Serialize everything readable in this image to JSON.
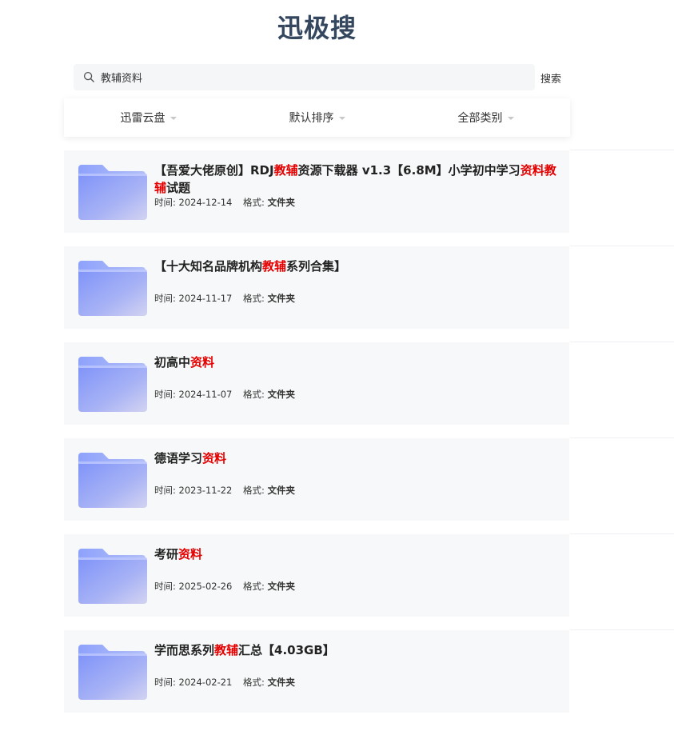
{
  "site": {
    "logo": "迅极搜"
  },
  "search": {
    "value": "教辅资料",
    "button_label": "搜索"
  },
  "filters": [
    {
      "label": "迅雷云盘"
    },
    {
      "label": "默认排序"
    },
    {
      "label": "全部类别"
    }
  ],
  "labels": {
    "time": "时间:",
    "format": "格式:"
  },
  "results": [
    {
      "title_parts": [
        {
          "text": "【吾爱大佬原创】RDJ",
          "hl": false
        },
        {
          "text": "教辅",
          "hl": true
        },
        {
          "text": "资源下载器 v1.3【6.8M】小学初中学习",
          "hl": false
        },
        {
          "text": "资料",
          "hl": true
        },
        {
          "text": "教辅",
          "hl": true
        },
        {
          "text": "试题",
          "hl": false
        }
      ],
      "date": "2024-12-14",
      "format": "文件夹"
    },
    {
      "title_parts": [
        {
          "text": "【十大知名品牌机构",
          "hl": false
        },
        {
          "text": "教辅",
          "hl": true
        },
        {
          "text": "系列合集】",
          "hl": false
        }
      ],
      "date": "2024-11-17",
      "format": "文件夹"
    },
    {
      "title_parts": [
        {
          "text": "初高中",
          "hl": false
        },
        {
          "text": "资料",
          "hl": true
        }
      ],
      "date": "2024-11-07",
      "format": "文件夹"
    },
    {
      "title_parts": [
        {
          "text": "德语学习",
          "hl": false
        },
        {
          "text": "资料",
          "hl": true
        }
      ],
      "date": "2023-11-22",
      "format": "文件夹"
    },
    {
      "title_parts": [
        {
          "text": "考研",
          "hl": false
        },
        {
          "text": "资料",
          "hl": true
        }
      ],
      "date": "2025-02-26",
      "format": "文件夹"
    },
    {
      "title_parts": [
        {
          "text": "学而思系列",
          "hl": false
        },
        {
          "text": "教辅",
          "hl": true
        },
        {
          "text": "汇总【4.03GB】",
          "hl": false
        }
      ],
      "date": "2024-02-21",
      "format": "文件夹"
    }
  ],
  "colors": {
    "highlight": "#e50000",
    "logo": "#35475e",
    "card_bg": "#f7f8f9"
  },
  "icons": {
    "search": "magnifier-icon",
    "result": "folder-icon",
    "filter_caret": "caret-down-icon"
  }
}
